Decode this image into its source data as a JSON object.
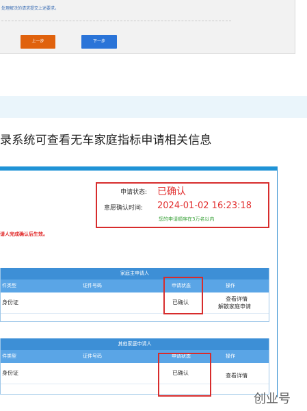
{
  "top": {
    "note": "处理解决的请求提交上述要求。",
    "prev_button": "上一步",
    "next_button": "下一步"
  },
  "caption": "录系统可查看无车家庭指标申请相关信息",
  "status": {
    "state_label": "申请状态:",
    "state_value": "已确认",
    "time_label": "意愿确认时间:",
    "time_value": "2024-01-02 16:23:18",
    "rank_note": "您的申请顺序在3万名以内"
  },
  "notice": "请人完成确认后生效。",
  "main_table": {
    "title": "家庭主申请人",
    "headers": [
      "件类型",
      "证件号码",
      "申请状态",
      "操作"
    ],
    "row": {
      "id_type": "身份证",
      "status": "已确认",
      "action_1": "查看详情",
      "action_2": "解散家庭申请"
    }
  },
  "other_table": {
    "title": "其他家庭申请人",
    "headers": [
      "件类型",
      "证件号码",
      "申请状态",
      "操作"
    ],
    "row": {
      "id_type": "身份证",
      "status": "已确认",
      "action_1": "查看详情"
    }
  },
  "watermark": "创业号",
  "colors": {
    "orange_button": "#e0620d",
    "blue_button": "#2a74d8",
    "highlight_red": "#d72c2c",
    "status_red": "#e23030",
    "table_header_blue": "#3d8fd6",
    "note_green": "#3aa23a"
  }
}
